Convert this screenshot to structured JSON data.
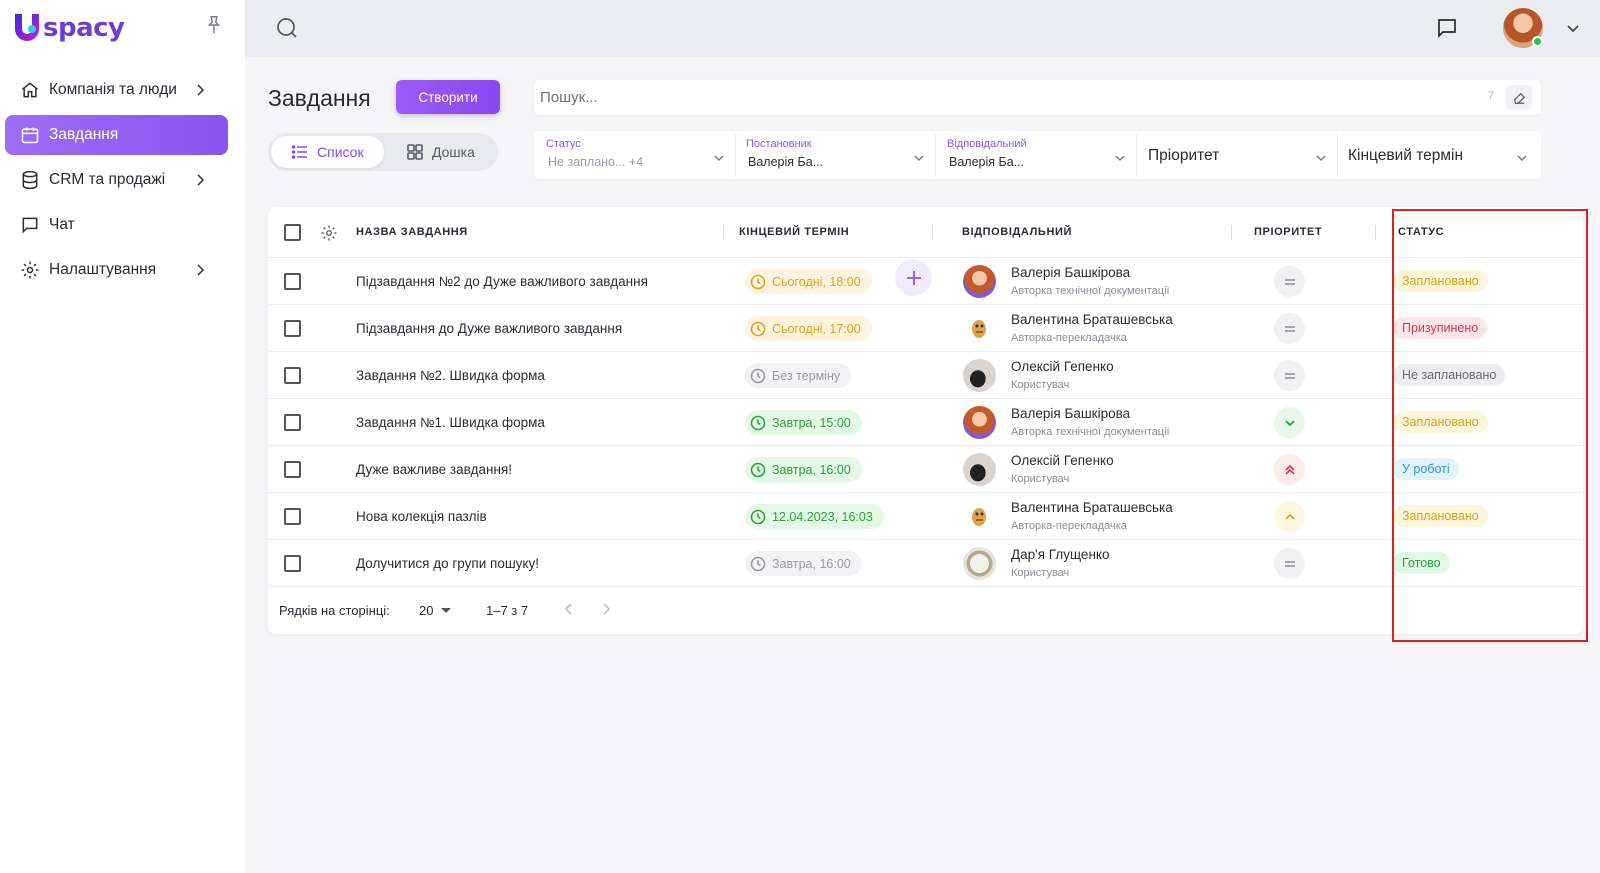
{
  "app": {
    "logo_text": "spacy",
    "brand_color": "#8a55f0"
  },
  "sidebar": {
    "items": [
      {
        "label": "Компанія та люди",
        "icon": "home-icon",
        "has_children": true,
        "active": false
      },
      {
        "label": "Завдання",
        "icon": "calendar-icon",
        "has_children": false,
        "active": true
      },
      {
        "label": "CRM та продажі",
        "icon": "database-icon",
        "has_children": true,
        "active": false
      },
      {
        "label": "Чат",
        "icon": "chat-icon",
        "has_children": false,
        "active": false
      },
      {
        "label": "Налаштування",
        "icon": "gear-icon",
        "has_children": true,
        "active": false
      }
    ]
  },
  "header": {
    "title": "Завдання",
    "create_label": "Створити",
    "view_list_label": "Список",
    "view_board_label": "Дошка",
    "search_placeholder": "Пошук...",
    "search_count": "7"
  },
  "filters": {
    "status": {
      "label": "Статус",
      "value": "Не заплано...",
      "extra": "+4"
    },
    "author": {
      "label": "Постановник",
      "value": "Валерія Ба..."
    },
    "assignee": {
      "label": "Відповідальний",
      "value": "Валерія Ба..."
    },
    "priority": {
      "placeholder": "Пріоритет"
    },
    "deadline": {
      "placeholder": "Кінцевий термін"
    }
  },
  "table": {
    "columns": {
      "name": "НАЗВА ЗАВДАННЯ",
      "deadline": "КІНЦЕВИЙ ТЕРМІН",
      "assignee": "ВІДПОВІДАЛЬНИЙ",
      "priority": "ПРІОРИТЕТ",
      "status": "СТАТУС"
    },
    "rows": [
      {
        "name": "Підзавдання №2 до Дуже важливого завдання",
        "deadline": "Сьогодні, 18:00",
        "deadline_color": "orange",
        "person": "Валерія Башкірова",
        "role": "Авторка технічної документації",
        "priority": "normal",
        "status": "Заплановано",
        "status_kind": "plan"
      },
      {
        "name": "Підзавдання до Дуже важливого завдання",
        "deadline": "Сьогодні, 17:00",
        "deadline_color": "orange",
        "person": "Валентина Браташевська",
        "role": "Авторка-перекладачка",
        "priority": "normal",
        "status": "Призупинено",
        "status_kind": "pause"
      },
      {
        "name": "Завдання №2. Швидка форма",
        "deadline": "Без терміну",
        "deadline_color": "gray",
        "person": "Олексій Гепенко",
        "role": "Користувач",
        "priority": "normal",
        "status": "Не заплановано",
        "status_kind": "none"
      },
      {
        "name": "Завдання №1. Швидка форма",
        "deadline": "Завтра, 15:00",
        "deadline_color": "green",
        "person": "Валерія Башкірова",
        "role": "Авторка технічної документації",
        "priority": "low",
        "status": "Заплановано",
        "status_kind": "plan"
      },
      {
        "name": "Дуже важливе завдання!",
        "deadline": "Завтра, 16:00",
        "deadline_color": "green",
        "person": "Олексій Гепенко",
        "role": "Користувач",
        "priority": "highest",
        "status": "У роботі",
        "status_kind": "work"
      },
      {
        "name": "Нова колекція пазлів",
        "deadline": "12.04.2023, 16:03",
        "deadline_color": "green",
        "person": "Валентина Браташевська",
        "role": "Авторка-перекладачка",
        "priority": "high",
        "status": "Заплановано",
        "status_kind": "plan"
      },
      {
        "name": "Долучитися до групи пошуку!",
        "deadline": "Завтра, 16:00",
        "deadline_color": "gray",
        "person": "Дар'я Глущенко",
        "role": "Користувач",
        "priority": "normal",
        "status": "Готово",
        "status_kind": "done"
      }
    ],
    "footer": {
      "rows_per_page_label": "Рядків на сторінці:",
      "rows_per_page": "20",
      "range": "1–7 з 7"
    }
  }
}
